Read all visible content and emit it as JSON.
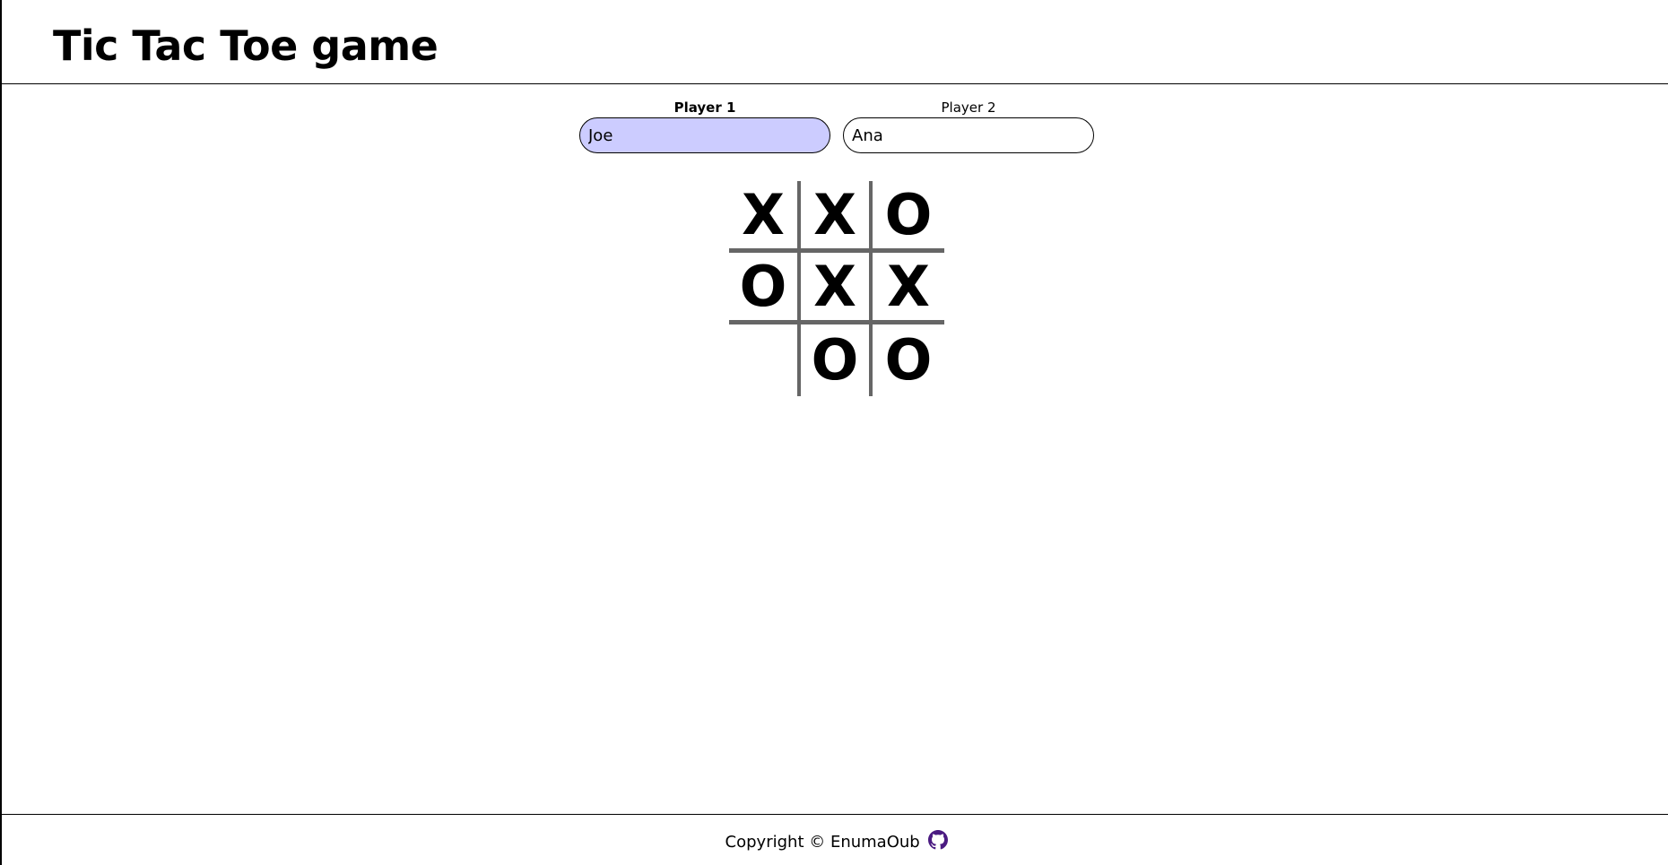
{
  "header": {
    "title": "Tic Tac Toe game"
  },
  "players": {
    "player1": {
      "label": "Player 1",
      "name": "Joe",
      "active": true
    },
    "player2": {
      "label": "Player 2",
      "name": "Ana",
      "active": false
    }
  },
  "board": {
    "cells": [
      "X",
      "X",
      "O",
      "O",
      "X",
      "X",
      "",
      "O",
      "O"
    ]
  },
  "footer": {
    "copyright": "Copyright © EnumaOub",
    "icon": "github-icon",
    "icon_color": "#4b1b82"
  },
  "colors": {
    "active_player_bg": "#ccccff",
    "grid_line": "#666666"
  }
}
